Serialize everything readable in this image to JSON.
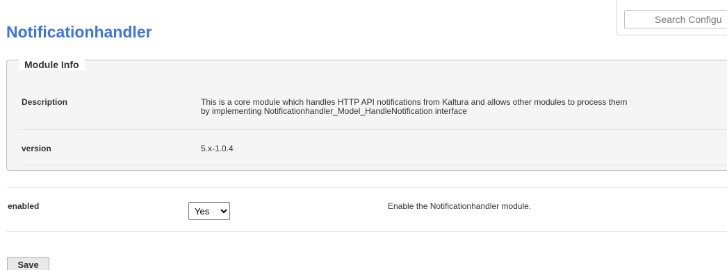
{
  "search": {
    "placeholder": "Search Configu"
  },
  "page_title": "Notificationhandler",
  "module_info": {
    "legend": "Module Info",
    "rows": [
      {
        "label": "Description",
        "value_line1": "This is a core module which handles HTTP API notifications from Kaltura and allows other modules to process them",
        "value_line2": "by implementing Notificationhandler_Model_HandleNotification interface"
      },
      {
        "label": "version",
        "value": "5.x-1.0.4"
      }
    ]
  },
  "config": {
    "enabled": {
      "label": "enabled",
      "selected": "Yes",
      "help": "Enable the Notificationhandler module."
    }
  },
  "actions": {
    "save_label": "Save"
  },
  "colors": {
    "title": "#3b73e8",
    "fieldset_bg": "#f5f5f5",
    "border": "#bdbdbd"
  }
}
